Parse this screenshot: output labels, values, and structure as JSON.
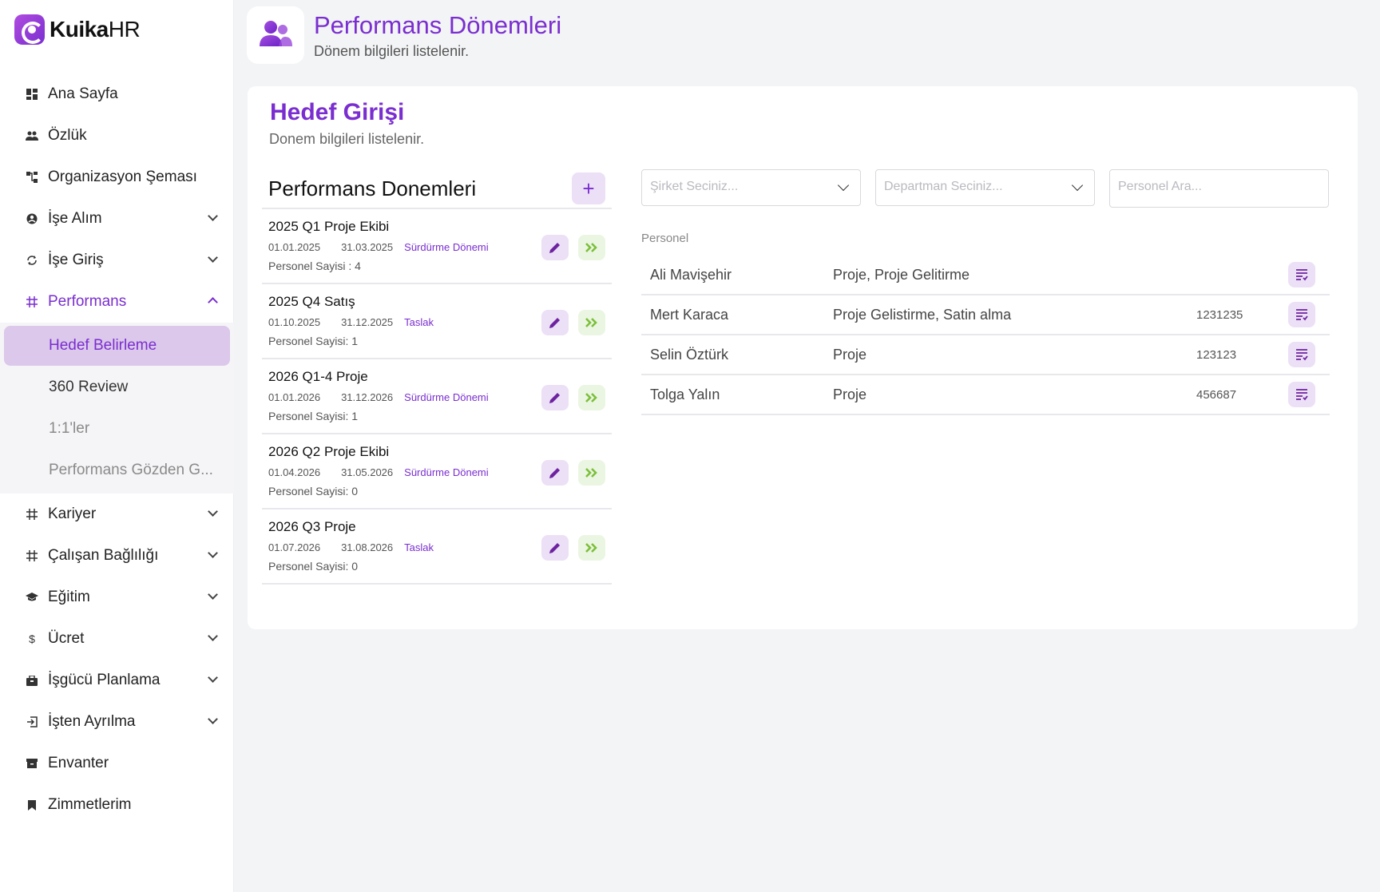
{
  "brand": {
    "name": "Kuika",
    "suffix": "HR"
  },
  "sidebar": {
    "items": [
      {
        "label": "Ana Sayfa",
        "icon": "dashboard-icon"
      },
      {
        "label": "Özlük",
        "icon": "people-icon"
      },
      {
        "label": "Organizasyon Şeması",
        "icon": "org-chart-icon"
      },
      {
        "label": "İşe Alım",
        "icon": "account-circle-icon"
      },
      {
        "label": "İşe Giriş",
        "icon": "sync-icon"
      },
      {
        "label": "Performans",
        "icon": "hash-icon"
      },
      {
        "label": "Kariyer",
        "icon": "hash-icon"
      },
      {
        "label": "Çalışan Bağlılığı",
        "icon": "hash-icon"
      },
      {
        "label": "Eğitim",
        "icon": "school-icon"
      },
      {
        "label": "Ücret",
        "icon": "dollar-icon"
      },
      {
        "label": "İşgücü Planlama",
        "icon": "briefcase-icon"
      },
      {
        "label": "İşten Ayrılma",
        "icon": "logout-icon"
      },
      {
        "label": "Envanter",
        "icon": "archive-icon"
      },
      {
        "label": "Zimmetlerim",
        "icon": "bookmark-icon"
      }
    ],
    "performans_sub": [
      {
        "label": "Hedef Belirleme"
      },
      {
        "label": "360 Review"
      },
      {
        "label": "1:1'ler"
      },
      {
        "label": "Performans Gözden G..."
      }
    ]
  },
  "header": {
    "title": "Performans Dönemleri",
    "subtitle": "Dönem bilgileri listelenir."
  },
  "card": {
    "title": "Hedef Girişi",
    "subtitle": "Donem bilgileri listelenir."
  },
  "periods": {
    "title": "Performans Donemleri",
    "add_label": "+",
    "items": [
      {
        "name": "2025 Q1 Proje Ekibi",
        "start": "01.01.2025",
        "end": "31.03.2025",
        "status": "Sürdürme Dönemi",
        "count": "Personel Sayisi : 4"
      },
      {
        "name": "2025 Q4 Satış",
        "start": "01.10.2025",
        "end": "31.12.2025",
        "status": "Taslak",
        "count": "Personel Sayisi: 1"
      },
      {
        "name": "2026 Q1-4 Proje",
        "start": "01.01.2026",
        "end": "31.12.2026",
        "status": "Sürdürme Dönemi",
        "count": "Personel Sayisi: 1"
      },
      {
        "name": "2026 Q2 Proje Ekibi",
        "start": "01.04.2026",
        "end": "31.05.2026",
        "status": "Sürdürme Dönemi",
        "count": "Personel Sayisi: 0"
      },
      {
        "name": "2026 Q3 Proje",
        "start": "01.07.2026",
        "end": "31.08.2026",
        "status": "Taslak",
        "count": "Personel Sayisi: 0"
      }
    ]
  },
  "filters": {
    "company_placeholder": "Şirket Seciniz...",
    "department_placeholder": "Departman Seciniz...",
    "search_placeholder": "Personel Ara..."
  },
  "personel": {
    "label": "Personel",
    "rows": [
      {
        "name": "Ali Mavişehir",
        "dept": "Proje, Proje Gelitirme",
        "number": ""
      },
      {
        "name": "Mert Karaca",
        "dept": "Proje Gelistirme, Satin alma",
        "number": "1231235"
      },
      {
        "name": "Selin Öztürk",
        "dept": "Proje",
        "number": "123123"
      },
      {
        "name": "Tolga Yalın",
        "dept": "Proje",
        "number": "456687"
      }
    ]
  },
  "colors": {
    "accent": "#7a2ed0",
    "accent_light": "#ece0f6",
    "go_green": "#7cbf3b"
  }
}
